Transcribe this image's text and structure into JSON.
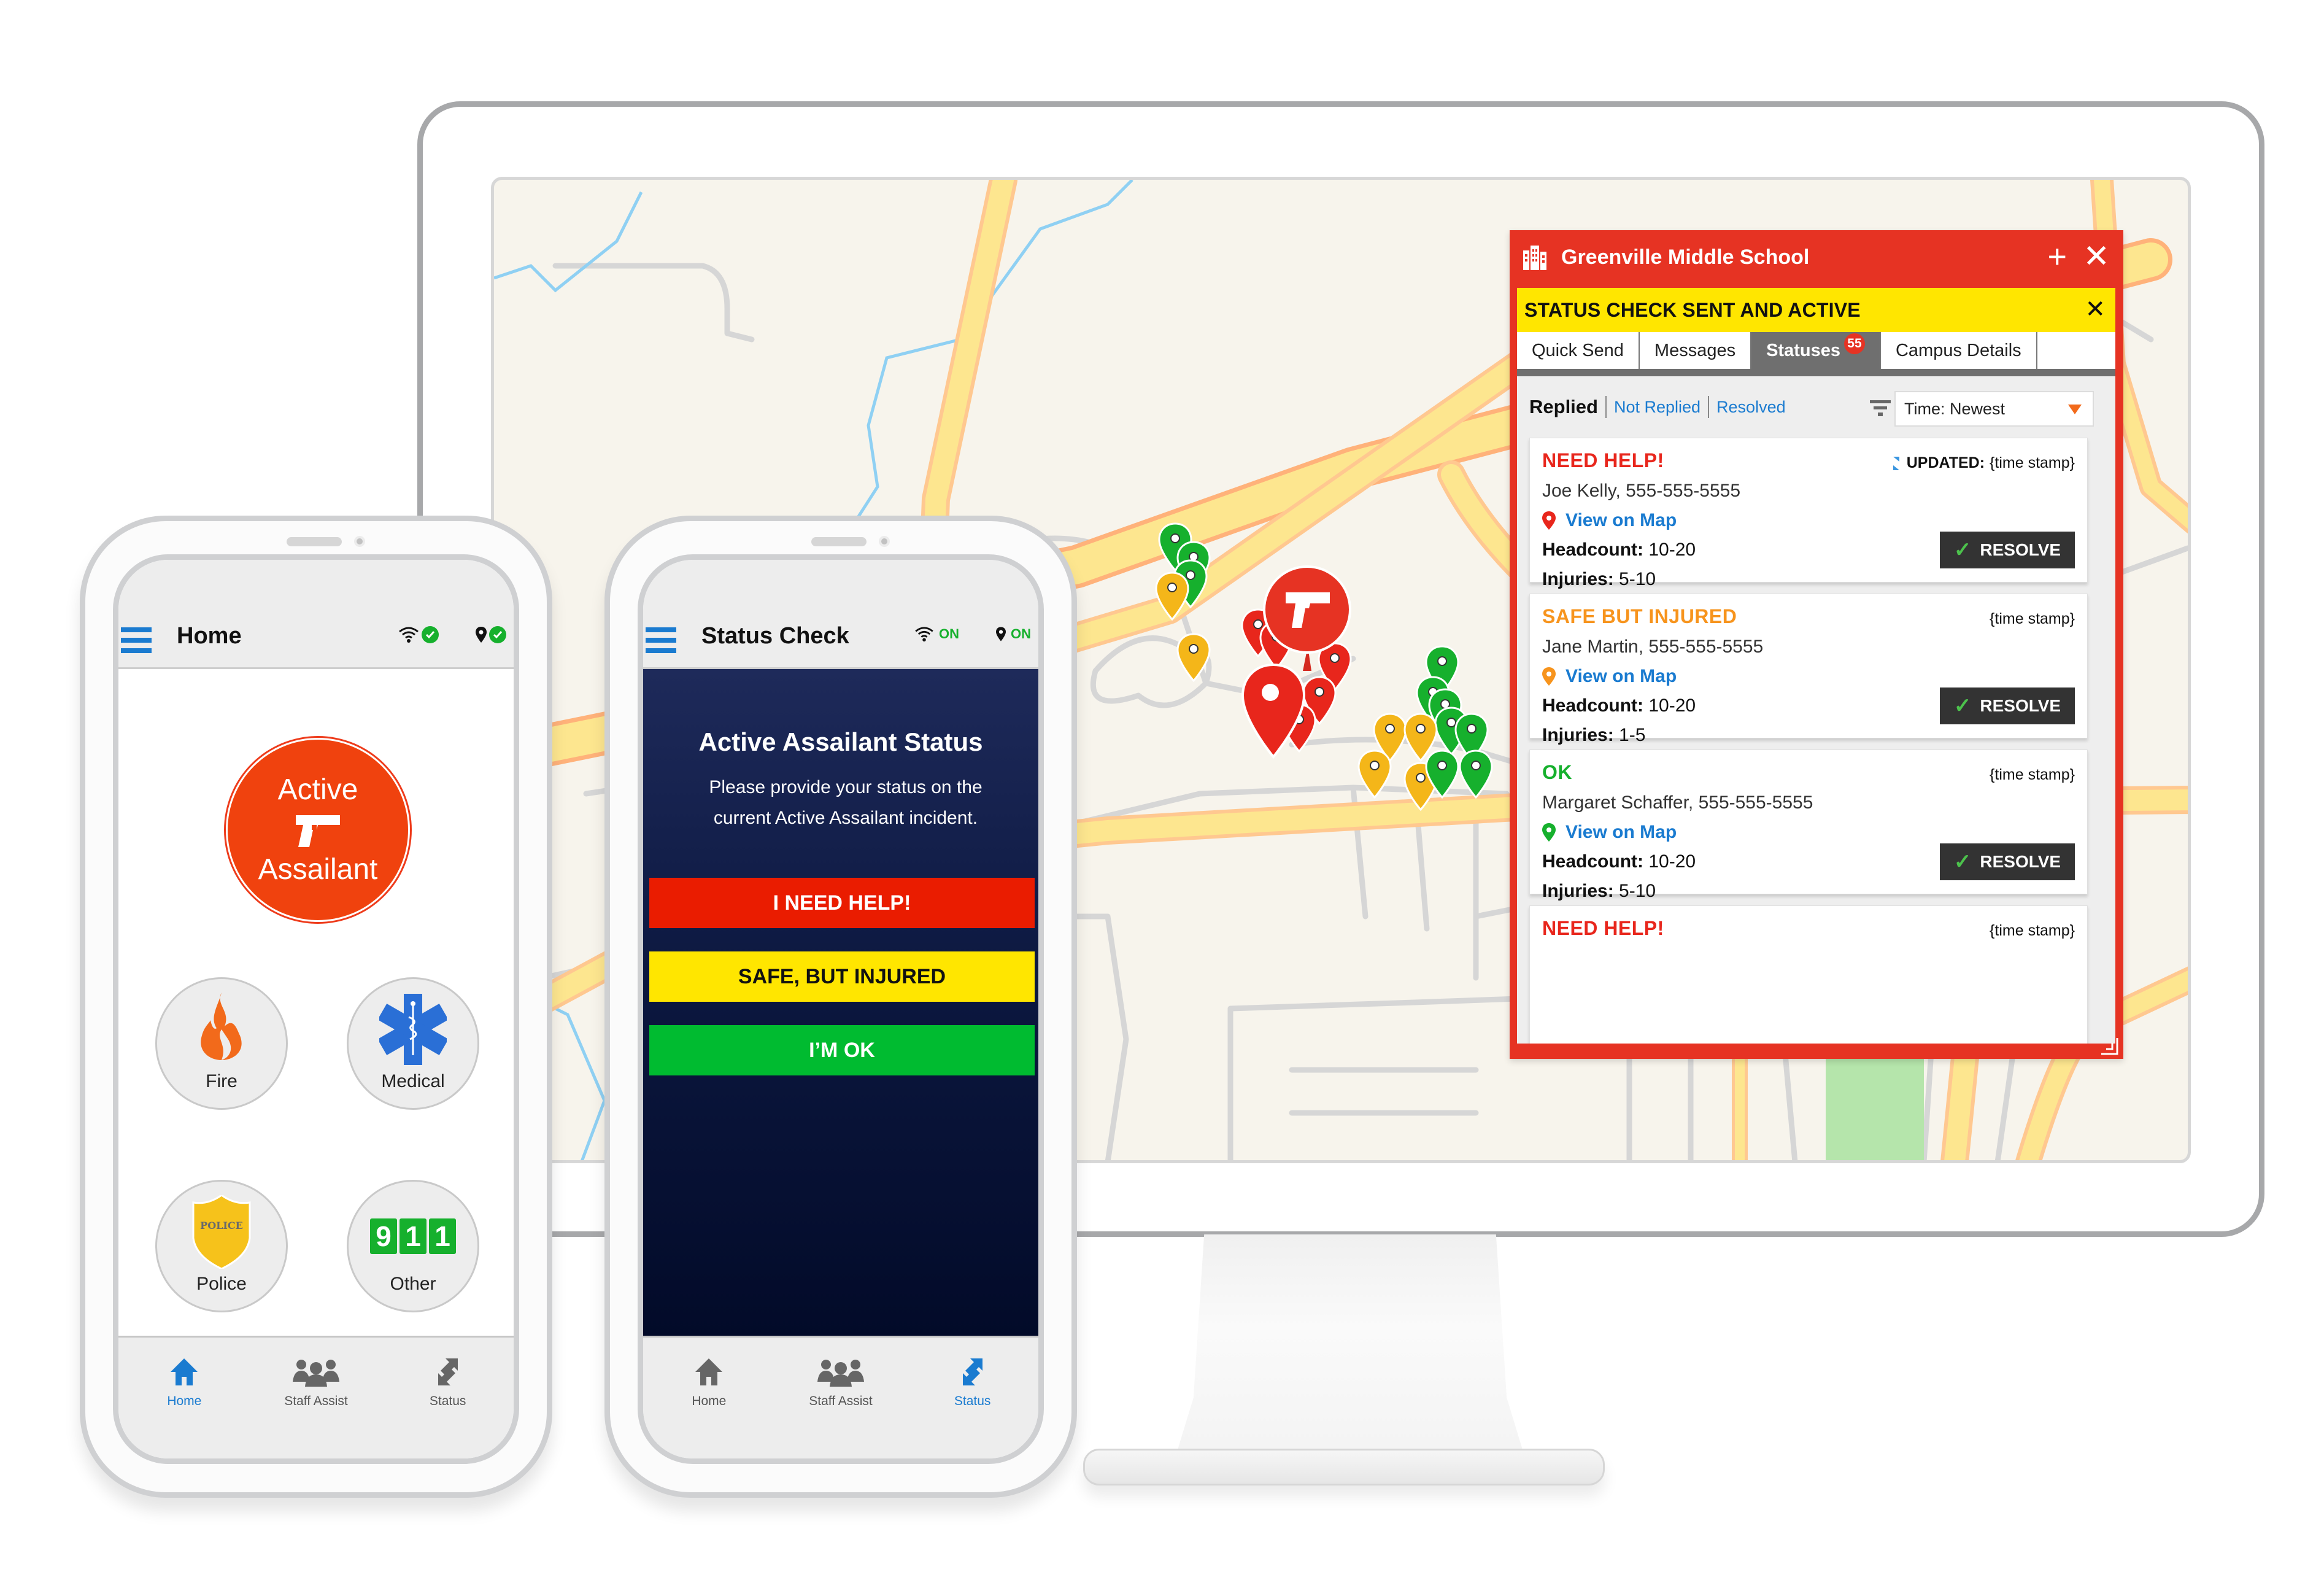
{
  "colors": {
    "accent_blue": "#1a7bd0",
    "alert_red": "#e63323",
    "banner_yellow": "#ffe600",
    "need_help_red": "#e8261c",
    "safe_injured_orange": "#f7941d",
    "ok_green": "#16b02d",
    "navy": "#0c1840"
  },
  "desktop": {
    "map": {
      "pins": [
        {
          "status": "ok",
          "icon": "map-pin-icon"
        },
        {
          "status": "injured",
          "icon": "map-pin-icon"
        },
        {
          "status": "need_help",
          "icon": "map-pin-icon"
        },
        {
          "status": "incident",
          "icon": "gun-icon"
        }
      ]
    },
    "panel": {
      "title": "Greenville Middle School",
      "building_icon": "building-icon",
      "add_label": "+",
      "close_label": "✕",
      "banner": {
        "text": "STATUS CHECK SENT AND ACTIVE",
        "close_label": "✕"
      },
      "tabs": [
        {
          "label": "Quick Send",
          "active": false
        },
        {
          "label": "Messages",
          "active": false
        },
        {
          "label": "Statuses",
          "active": true,
          "badge": "55"
        },
        {
          "label": "Campus Details",
          "active": false
        }
      ],
      "filters": {
        "active": "Replied",
        "links": [
          "Not Replied",
          "Resolved"
        ],
        "sort_label": "Time: Newest"
      },
      "cards": [
        {
          "status": "NEED HELP!",
          "status_color": "#e8261c",
          "updated_label": "UPDATED:",
          "timestamp": "{time stamp}",
          "name": "Joe Kelly, 555-555-5555",
          "map_link": "View on Map",
          "pin_color": "#e8261c",
          "headcount_label": "Headcount:",
          "headcount": "10-20",
          "injuries_label": "Injuries:",
          "injuries": "5-10",
          "resolve_label": "RESOLVE"
        },
        {
          "status": "SAFE BUT INJURED",
          "status_color": "#f7941d",
          "timestamp": "{time stamp}",
          "name": "Jane Martin, 555-555-5555",
          "map_link": "View on Map",
          "pin_color": "#f7941d",
          "headcount_label": "Headcount:",
          "headcount": "10-20",
          "injuries_label": "Injuries:",
          "injuries": "1-5",
          "resolve_label": "RESOLVE"
        },
        {
          "status": "OK",
          "status_color": "#16b02d",
          "timestamp": "{time stamp}",
          "name": "Margaret Schaffer, 555-555-5555",
          "map_link": "View on Map",
          "pin_color": "#16b02d",
          "headcount_label": "Headcount:",
          "headcount": "10-20",
          "injuries_label": "Injuries:",
          "injuries": "5-10",
          "resolve_label": "RESOLVE"
        },
        {
          "status": "NEED HELP!",
          "status_color": "#e8261c",
          "timestamp": "{time stamp}"
        }
      ]
    }
  },
  "phone_home": {
    "title": "Home",
    "wifi_status": "check",
    "location_status": "check",
    "active_assailant": {
      "line1": "Active",
      "line2": "Assailant"
    },
    "emergency_buttons": [
      {
        "label": "Fire",
        "icon": "fire-icon"
      },
      {
        "label": "Medical",
        "icon": "star-of-life-icon"
      },
      {
        "label": "Police",
        "icon": "police-badge-icon",
        "badge_text": "POLICE"
      },
      {
        "label": "Other",
        "icon": "911-icon",
        "digits": [
          "9",
          "1",
          "1"
        ]
      }
    ],
    "tabs": [
      {
        "label": "Home",
        "active": true
      },
      {
        "label": "Staff Assist",
        "active": false
      },
      {
        "label": "Status",
        "active": false
      }
    ]
  },
  "phone_status": {
    "title": "Status Check",
    "wifi_label": "ON",
    "location_label": "ON",
    "heading": "Active Assailant Status",
    "description": "Please provide your status on the current Active Assailant incident.",
    "buttons": [
      {
        "label": "I NEED HELP!",
        "bg": "#ea1c00",
        "fg": "#ffffff"
      },
      {
        "label": "SAFE, BUT INJURED",
        "bg": "#ffe600",
        "fg": "#111111"
      },
      {
        "label": "I’M OK",
        "bg": "#00bb30",
        "fg": "#ffffff"
      }
    ],
    "tabs": [
      {
        "label": "Home",
        "active": false
      },
      {
        "label": "Staff Assist",
        "active": false
      },
      {
        "label": "Status",
        "active": true
      }
    ]
  }
}
